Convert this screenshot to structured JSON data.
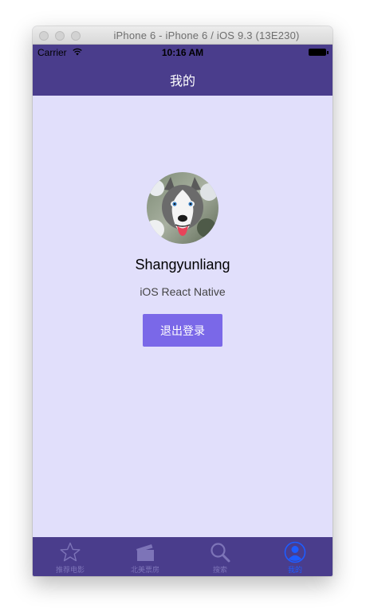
{
  "window": {
    "title": "iPhone 6 - iPhone 6 / iOS 9.3 (13E230)"
  },
  "status_bar": {
    "carrier": "Carrier",
    "time": "10:16 AM"
  },
  "nav": {
    "title": "我的"
  },
  "profile": {
    "avatar_icon": "husky-dog-photo",
    "username": "Shangyunliang",
    "subtitle": "iOS React Native",
    "logout_label": "退出登录"
  },
  "tabs": [
    {
      "label": "推荐电影",
      "icon": "star-icon"
    },
    {
      "label": "北美票房",
      "icon": "clapperboard-icon"
    },
    {
      "label": "搜索",
      "icon": "search-icon"
    },
    {
      "label": "我的",
      "icon": "user-icon",
      "active": true
    }
  ],
  "colors": {
    "bar": "#4a3d8c",
    "content_bg": "#e1dffb",
    "button": "#7a68e8",
    "active_tab": "#1e5cff",
    "inactive_tab": "#7d74b8"
  }
}
